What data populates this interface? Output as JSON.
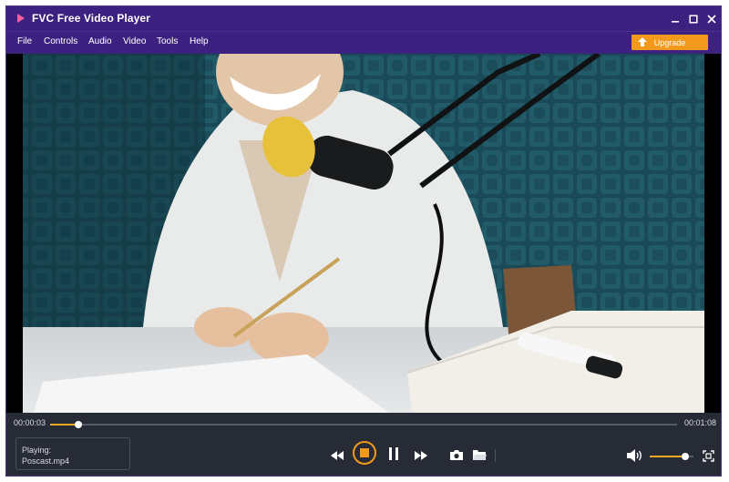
{
  "app": {
    "title": "FVC Free Video Player"
  },
  "menu": {
    "items": [
      "File",
      "Controls",
      "Audio",
      "Video",
      "Tools",
      "Help"
    ]
  },
  "upgrade": {
    "label": "Upgrade"
  },
  "playback": {
    "elapsed": "00:00:03",
    "duration": "00:01:08",
    "progress": 0.045,
    "playing_label": "Playing:",
    "filename": "Poscast.mp4",
    "volume": 0.82
  },
  "colors": {
    "titlebar": "#3c2180",
    "accent": "#f39a1c",
    "controls_bg": "#262b35"
  },
  "icons": {
    "window": [
      "minimize-icon",
      "maximize-icon",
      "close-icon"
    ],
    "transport": [
      "rewind-icon",
      "stop-icon",
      "pause-icon",
      "fast-forward-icon",
      "camera-icon",
      "folder-icon",
      "volume-icon",
      "fullscreen-icon"
    ]
  }
}
